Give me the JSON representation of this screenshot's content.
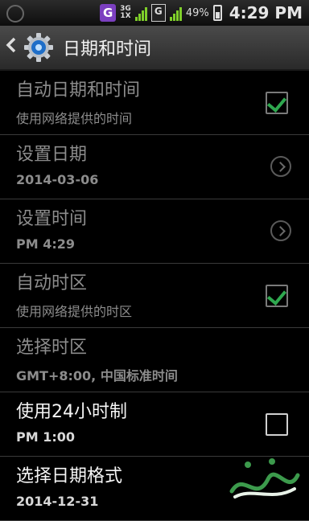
{
  "status_bar": {
    "network_top": "3G",
    "network_bottom": "1X",
    "g_badge": "G",
    "battery_percent": "49%",
    "time": "4:29 PM"
  },
  "header": {
    "title": "日期和时间",
    "back_icon": "chevron-left-icon",
    "app_icon": "settings-gear-icon"
  },
  "rows": [
    {
      "title": "自动日期和时间",
      "summary": "使用网络提供的时间",
      "control": "checkbox",
      "checked": true
    },
    {
      "title": "设置日期",
      "summary": "2014-03-06",
      "control": "chevron"
    },
    {
      "title": "设置时间",
      "summary": "PM 4:29",
      "control": "chevron"
    },
    {
      "title": "自动时区",
      "summary": "使用网络提供的时区",
      "control": "checkbox",
      "checked": true
    },
    {
      "title": "选择时区",
      "summary": "GMT+8:00, 中国标准时间",
      "control": "none"
    },
    {
      "title": "使用24小时制",
      "summary": "PM 1:00",
      "control": "checkbox",
      "checked": false
    },
    {
      "title": "选择日期格式",
      "summary": "2014-12-31",
      "control": "none"
    }
  ],
  "colors": {
    "accent": "#2fa84f",
    "disabled_text": "#8c8c8c",
    "active_text": "#f5f5f5"
  }
}
